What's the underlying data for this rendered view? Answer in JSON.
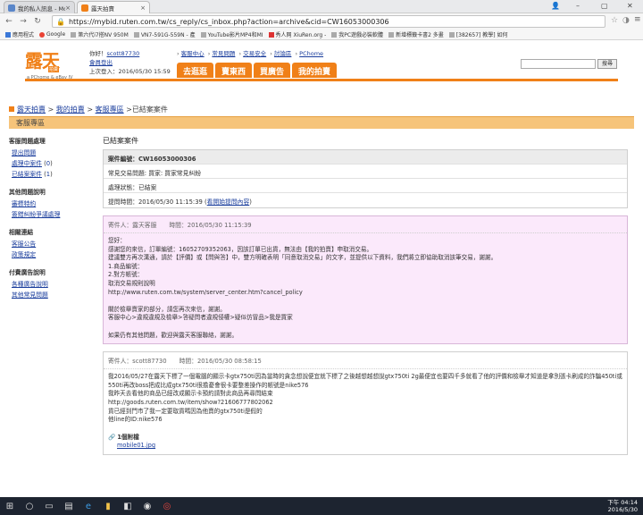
{
  "browser": {
    "tabs": [
      {
        "title": "我的私人訊息 - Mobile01",
        "active": false
      },
      {
        "title": "露天拍賣",
        "active": true
      }
    ],
    "url": "https://mybid.ruten.com.tw/cs_reply/cs_inbox.php?action=archive&cid=CW16053000306",
    "bookmarks": [
      "應用程式",
      "Google",
      "第六代i7搭NV 950M",
      "VN7-591G-559N - 產",
      "YouTube影片MP4和MI",
      "秀人网 XiuRen.org -",
      "我PC遊戲必裝軟體",
      "新增標籤卡書2 多畫",
      "[382657] 教學] 如何"
    ]
  },
  "site": {
    "logo_text": "露天",
    "logo_badge": "拍賣",
    "logo_sub": "a PChome & eBay JV",
    "user_prefix": "你好！",
    "username": "scott87730",
    "member_logout": "會員登出",
    "last_login": "上次登入：2016/05/30 15:59",
    "top_links": [
      "客服中心",
      "常見問題",
      "交易安全",
      "討論區",
      "PChome"
    ],
    "tabs": [
      "去逛逛",
      "賣東西",
      "買廣告",
      "我的拍賣"
    ],
    "search_button": "搜尋"
  },
  "breadcrumb": {
    "root": "露天拍賣",
    "l2": "我的拍賣",
    "l3": "客服專區",
    "current": "已結案案件"
  },
  "section_title": "客服專區",
  "sidebar": {
    "groups": [
      {
        "title": "客服問題處理",
        "items": [
          {
            "label": "提出問題",
            "count": ""
          },
          {
            "label": "處理中案件",
            "count": "0"
          },
          {
            "label": "已結案案件",
            "count": "1"
          }
        ]
      },
      {
        "title": "其他問題說明",
        "items": [
          {
            "label": "審標特約",
            "count": ""
          },
          {
            "label": "簽錯糾紛爭議處理",
            "count": ""
          }
        ]
      },
      {
        "title": "相關連結",
        "items": [
          {
            "label": "客服公告",
            "count": ""
          },
          {
            "label": "政策規定",
            "count": ""
          }
        ]
      },
      {
        "title": "付費廣告說明",
        "items": [
          {
            "label": "各種廣告說明",
            "count": ""
          },
          {
            "label": "其他常見問題",
            "count": ""
          }
        ]
      }
    ]
  },
  "main": {
    "title": "已結案案件",
    "case_no_label": "案件編號：",
    "case_no": "CW16053000306",
    "category": "常見交易問題: 買家: 買家常見糾紛",
    "status": "處理狀態：已結案",
    "submit_time": "提問時間：2016/05/30 11:15:39",
    "submit_link": "看開始提問內容"
  },
  "messages": [
    {
      "sender_label": "寄件人：露天客服",
      "time_label": "時間：2016/05/30 11:15:39",
      "body": "您好：\n感謝您的來信，訂單編號：16052709352063，因該訂單已出貨，無法由【我的拍賣】申取消交易。\n建議雙方再次溝通，請於【評價】或【問與答】中，雙方明確表明「同意取消交易」的文字，並提供以下資料，我們將立即協助取消該筆交易，謝謝。\n1.商品編號：\n2.對方帳號：\n取消交易規則說明\nhttp://www.ruten.com.tw/system/server_center.htm?cancel_policy\n\n關於檢舉賣家的部分，請您再次來信，謝謝。\n客服中心>違規違規及檢舉>答疑問者違規侵權>疑似仿冒品>我是買家\n\n如果仍有其他問題，歡迎與露天客服聯絡，謝謝。"
    },
    {
      "sender_label": "寄件人：scott87730",
      "time_label": "時間：2016/05/30 08:58:15",
      "body": "我2016/05/27在露天下標了一個電腦的顯示卡gtx750ti因為當時的貪念想說便宜就下標了之後越想越想說gtx750ti 2g最便宜也要四千多就看了他的評價和檢舉才知道是拿別張卡刷成的詐騙450ti或550ti再改boss把成比成gtx750ti很擔憂會很卡要整差操作的帳號是nike576\n我昨天去看他的商品已經改成顯示卡預約請對此商品再尋問結束\nhttp://goods.ruten.com.tw/item/show?21606777802062\n貨已經到門市了我一定要取貨嗎因為他賣的gtx750ti是假的\n他line的ID:nike576",
      "attach_count": "1個附檔",
      "attach_file": "mobile01.jpg"
    }
  ],
  "taskbar": {
    "time": "下午 04:14",
    "date": "2016/5/30"
  }
}
